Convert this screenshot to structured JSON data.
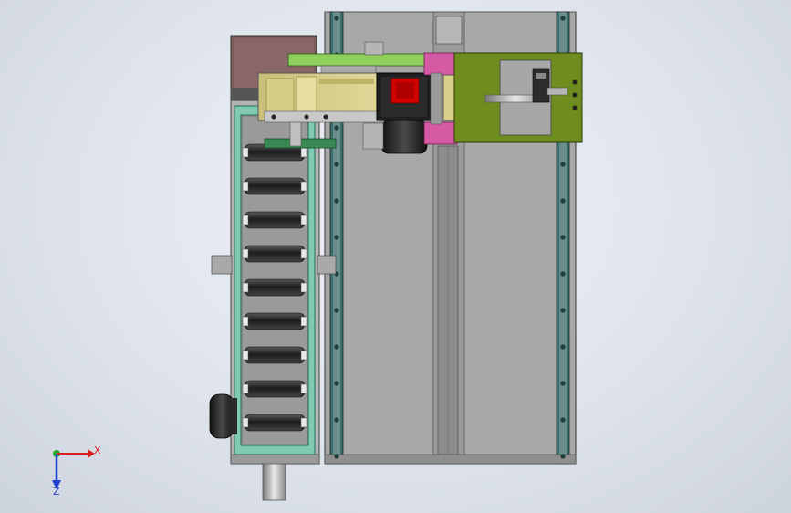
{
  "colors": {
    "background": "#dfe4ec",
    "frame_gray": "#a9a9a9",
    "rail_teal": "#2f6f6a",
    "teal_light": "#7fc9b0",
    "roller_dark": "#2e2e2e",
    "yellow_plate": "#d9cf8a",
    "green_arm": "#8fcf58",
    "olive_block": "#6f8f1f",
    "magenta_bracket": "#d45aa0",
    "motor_black": "#1d1d1d",
    "motor_red": "#d40000",
    "brown_box": "#7a5a5a",
    "axis_x": "#d62020",
    "axis_y": "#1faa2a",
    "axis_z": "#1f3fd0"
  },
  "triad": {
    "x_label": "X",
    "z_label": "Z"
  },
  "icons": {
    "triad": "coordinate-triad-icon"
  }
}
